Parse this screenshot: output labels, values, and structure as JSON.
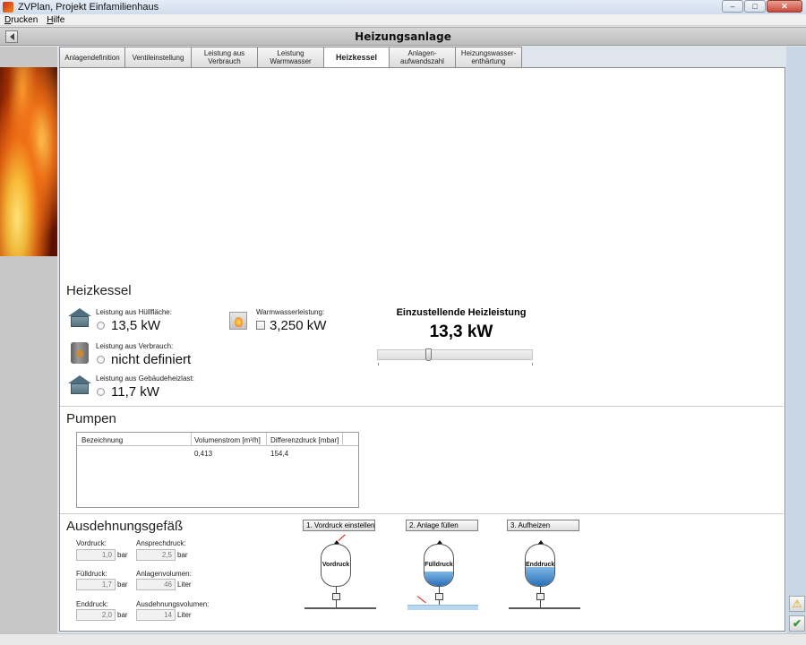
{
  "window": {
    "title": "ZVPlan, Projekt Einfamilienhaus"
  },
  "menu": {
    "items": [
      {
        "label": "Drucken",
        "u": "D",
        "rest": "rucken"
      },
      {
        "label": "Hilfe",
        "u": "H",
        "rest": "ilfe"
      }
    ]
  },
  "header": {
    "title": "Heizungsanlage"
  },
  "tabs": [
    {
      "line1": "Anlagendefinition",
      "line2": ""
    },
    {
      "line1": "Ventileinstellung",
      "line2": ""
    },
    {
      "line1": "Leistung aus",
      "line2": "Verbrauch"
    },
    {
      "line1": "Leistung",
      "line2": "Warmwasser"
    },
    {
      "line1": "Heizkessel",
      "line2": ""
    },
    {
      "line1": "Anlagen-",
      "line2": "aufwandszahl"
    },
    {
      "line1": "Heizungswasser-",
      "line2": "enthärtung"
    }
  ],
  "active_tab": "Heizkessel",
  "heizkessel": {
    "title": "Heizkessel",
    "huellflaeche": {
      "label": "Leistung aus Hüllfläche:",
      "value": "13,5 kW"
    },
    "verbrauch": {
      "label": "Leistung aus Verbrauch:",
      "value": "nicht definiert"
    },
    "gebaeude": {
      "label": "Leistung aus Gebäudeheizlast:",
      "value": "11,7 kW"
    },
    "warmwasser": {
      "label": "Warmwasserleistung:",
      "value": "3,250 kW"
    },
    "einstellung": {
      "title": "Einzustellende Heizleistung",
      "value": "13,3 kW",
      "slider_fraction": 0.33
    }
  },
  "pumpen": {
    "title": "Pumpen",
    "columns": [
      "Bezeichnung",
      "Volumenstrom [m³/h]",
      "Differenzdruck [mbar]"
    ],
    "rows": [
      [
        "",
        "0,413",
        "154,4"
      ]
    ]
  },
  "ausdehnung": {
    "title": "Ausdehnungsgefäß",
    "vordruck": {
      "label": "Vordruck:",
      "value": "1,0",
      "unit": "bar"
    },
    "fuelldruck": {
      "label": "Fülldruck:",
      "value": "1,7",
      "unit": "bar"
    },
    "enddruck": {
      "label": "Enddruck:",
      "value": "2,0",
      "unit": "bar"
    },
    "ansprechdruck": {
      "label": "Ansprechdruck:",
      "value": "2,5",
      "unit": "bar"
    },
    "anlagenvolumen": {
      "label": "Anlagenvolumen:",
      "value": "46",
      "unit": "Liter"
    },
    "ausdehnungsvolumen": {
      "label": "Ausdehnungsvolumen:",
      "value": "14",
      "unit": "Liter"
    },
    "steps": [
      {
        "title": "1. Vordruck einstellen",
        "vessel_label": "Vordruck",
        "water_fraction": 0.0
      },
      {
        "title": "2. Anlage füllen",
        "vessel_label": "Fülldruck",
        "water_fraction": 0.35
      },
      {
        "title": "3. Aufheizen",
        "vessel_label": "Enddruck",
        "water_fraction": 0.45
      }
    ]
  },
  "icons": {
    "back": "back-arrow-icon",
    "warning": "warning-icon",
    "confirm": "check-icon"
  }
}
